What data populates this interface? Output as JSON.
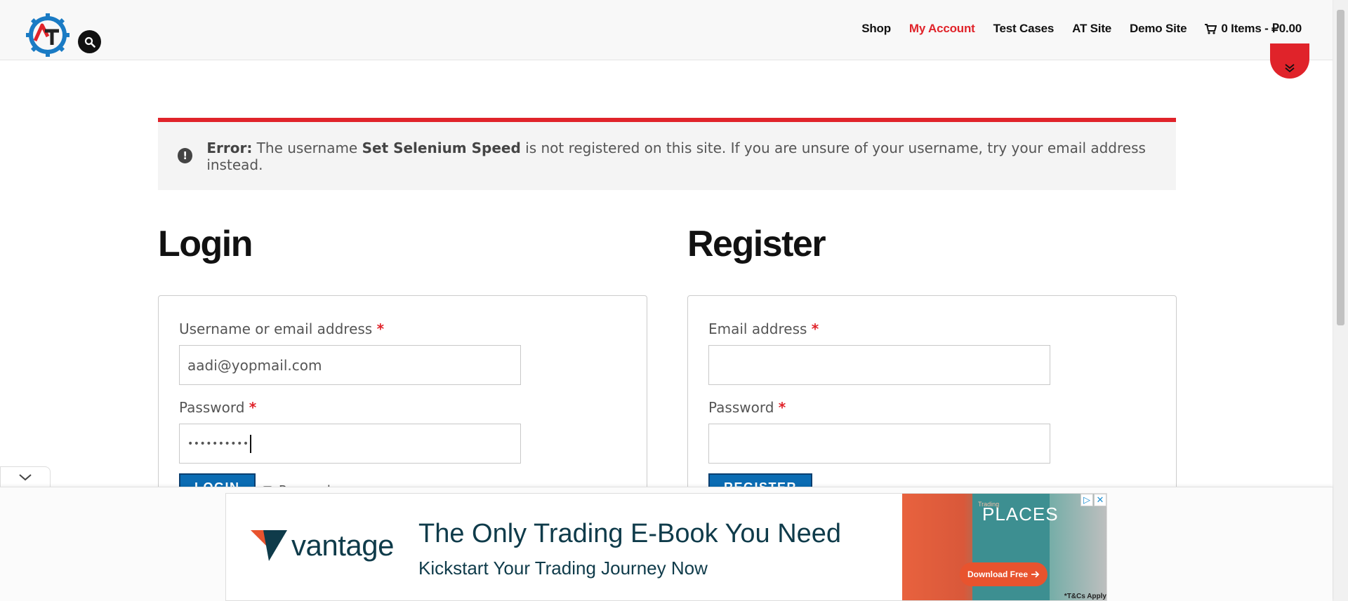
{
  "header": {
    "logo_letters": "AT",
    "nav": {
      "shop": "Shop",
      "my_account": "My Account",
      "test_cases": "Test Cases",
      "at_site": "AT Site",
      "demo_site": "Demo Site",
      "cart": "0 Items - ₽0.00"
    }
  },
  "notice": {
    "prefix": "Error:",
    "text_before": " The username ",
    "username": "Set Selenium Speed",
    "text_after": " is not registered on this site. If you are unsure of your username, try your email address instead."
  },
  "login": {
    "title": "Login",
    "username_label": "Username or email address",
    "username_value": "aadi@yopmail.com",
    "password_label": "Password",
    "password_value": "••••••••••",
    "button": "LOGIN",
    "remember": "Remember me"
  },
  "register": {
    "title": "Register",
    "email_label": "Email address",
    "password_label": "Password",
    "button": "REGISTER"
  },
  "required_mark": "*",
  "ad": {
    "brand": "vantage",
    "headline": "The Only Trading E-Book You Need",
    "subline": "Kickstart Your Trading Journey Now",
    "book_small": "Trading",
    "book_title": "PLACES",
    "download": "Download Free",
    "tc": "*T&Cs Apply"
  },
  "colors": {
    "accent_red": "#e0232a",
    "button_blue": "#0b6cb3"
  }
}
